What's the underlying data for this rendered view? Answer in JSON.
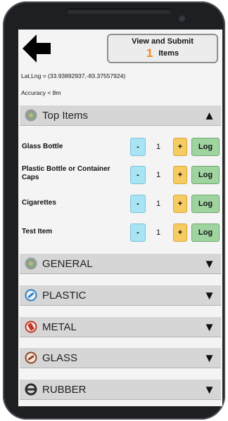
{
  "header": {
    "submit_title": "View and Submit",
    "submit_count": "1",
    "submit_suffix": "Items",
    "latlng": "Lat,Lng = (33.93892937,-83.37557924)",
    "accuracy": "Accuracy < 8m"
  },
  "sections": [
    {
      "label": "Top Items",
      "icon": "globe-icon",
      "expanded": true
    },
    {
      "label": "GENERAL",
      "icon": "globe-icon",
      "expanded": false
    },
    {
      "label": "PLASTIC",
      "icon": "plastic-bottle-icon",
      "expanded": false
    },
    {
      "label": "METAL",
      "icon": "metal-can-icon",
      "expanded": false
    },
    {
      "label": "GLASS",
      "icon": "glass-bottle-icon",
      "expanded": false
    },
    {
      "label": "RUBBER",
      "icon": "tire-icon",
      "expanded": false
    }
  ],
  "top_items": [
    {
      "name": "Glass Bottle",
      "qty": "1"
    },
    {
      "name": "Plastic Bottle or Container Caps",
      "qty": "1"
    },
    {
      "name": "Cigarettes",
      "qty": "1"
    },
    {
      "name": "Test Item",
      "qty": "1"
    }
  ],
  "buttons": {
    "minus": "-",
    "plus": "+",
    "log": "Log"
  },
  "chevrons": {
    "up": "▲",
    "down": "▼"
  },
  "colors": {
    "minus": "#a8e4f4",
    "plus": "#f6cc62",
    "log": "#9fd39f",
    "count": "#f08c1a",
    "section_bar": "#d6d6d6"
  }
}
